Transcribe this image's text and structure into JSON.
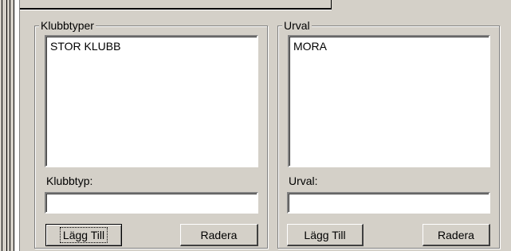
{
  "left_group": {
    "title": "Klubbtyper",
    "list_items": [
      "STOR KLUBB"
    ],
    "field_label": "Klubbtyp:",
    "field_value": "",
    "add_label": "Lägg Till",
    "delete_label": "Radera"
  },
  "right_group": {
    "title": "Urval",
    "list_items": [
      "MORA"
    ],
    "field_label": "Urval:",
    "field_value": "",
    "add_label": "Lägg Till",
    "delete_label": "Radera"
  }
}
